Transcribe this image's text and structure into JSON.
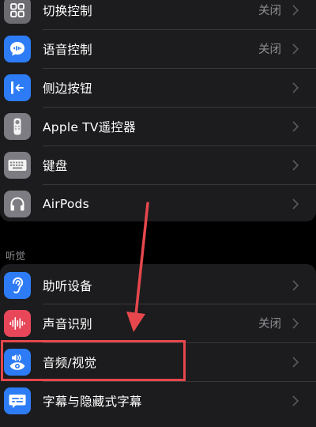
{
  "section_top": {
    "items": [
      {
        "label": "切换控制",
        "value": "关闭",
        "icon": "switch-control-icon",
        "icon_color": "#6b6b70"
      },
      {
        "label": "语音控制",
        "value": "关闭",
        "icon": "voice-control-icon",
        "icon_color": "#2d7cf6"
      },
      {
        "label": "侧边按钮",
        "value": "",
        "icon": "side-button-icon",
        "icon_color": "#2d7cf6"
      },
      {
        "label": "Apple TV遥控器",
        "value": "",
        "icon": "apple-tv-remote-icon",
        "icon_color": "#7c7c82"
      },
      {
        "label": "键盘",
        "value": "",
        "icon": "keyboard-icon",
        "icon_color": "#7c7c82"
      },
      {
        "label": "AirPods",
        "value": "",
        "icon": "airpods-icon",
        "icon_color": "#7c7c82"
      }
    ]
  },
  "section_hearing": {
    "header": "听觉",
    "items": [
      {
        "label": "助听设备",
        "value": "",
        "icon": "hearing-device-icon",
        "icon_color": "#2d7cf6"
      },
      {
        "label": "声音识别",
        "value": "关闭",
        "icon": "sound-recognition-icon",
        "icon_color": "#e8475a"
      },
      {
        "label": "音频/视觉",
        "value": "",
        "icon": "audio-visual-icon",
        "icon_color": "#2d7cf6"
      },
      {
        "label": "字幕与隐藏式字幕",
        "value": "",
        "icon": "subtitles-icon",
        "icon_color": "#2d7cf6"
      }
    ]
  },
  "annotation": {
    "highlight_color": "#e5474c",
    "arrow_color": "#e5474c"
  }
}
